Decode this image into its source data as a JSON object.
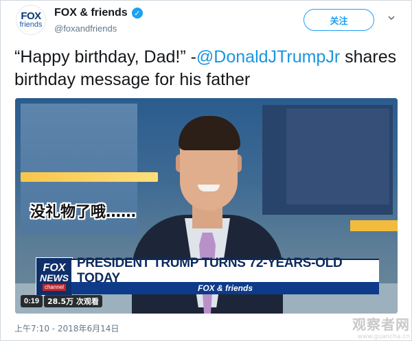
{
  "account": {
    "avatar_top": "FOX",
    "avatar_bottom": "friends",
    "display_name": "FOX & friends",
    "handle": "@foxandfriends",
    "verified_icon": "verified-badge-icon"
  },
  "actions": {
    "follow_label": "关注",
    "more_icon": "chevron-down-icon"
  },
  "tweet": {
    "text_before": "“Happy birthday, Dad!” -",
    "mention": "@DonaldJTrumpJr",
    "text_after": " shares birthday message for his father",
    "timestamp": "上午7:10 - 2018年6月14日"
  },
  "video": {
    "subtitle": "没礼物了哦……",
    "chyron_logo_line1": "FOX",
    "chyron_logo_line2": "NEWS",
    "chyron_logo_line3": "channel",
    "chyron_headline": "PRESIDENT TRUMP TURNS 72-YEARS-OLD TODAY",
    "chyron_show": "FOX & friends",
    "duration": "0:19",
    "views": "28.5万 次观看"
  },
  "watermark": {
    "line1": "观察者网",
    "line2": "www.guancha.cn"
  },
  "colors": {
    "accent": "#1da1f2",
    "mention": "#1b95e0",
    "secondary_text": "#657786",
    "chyron_navy": "#0d2a5c"
  }
}
